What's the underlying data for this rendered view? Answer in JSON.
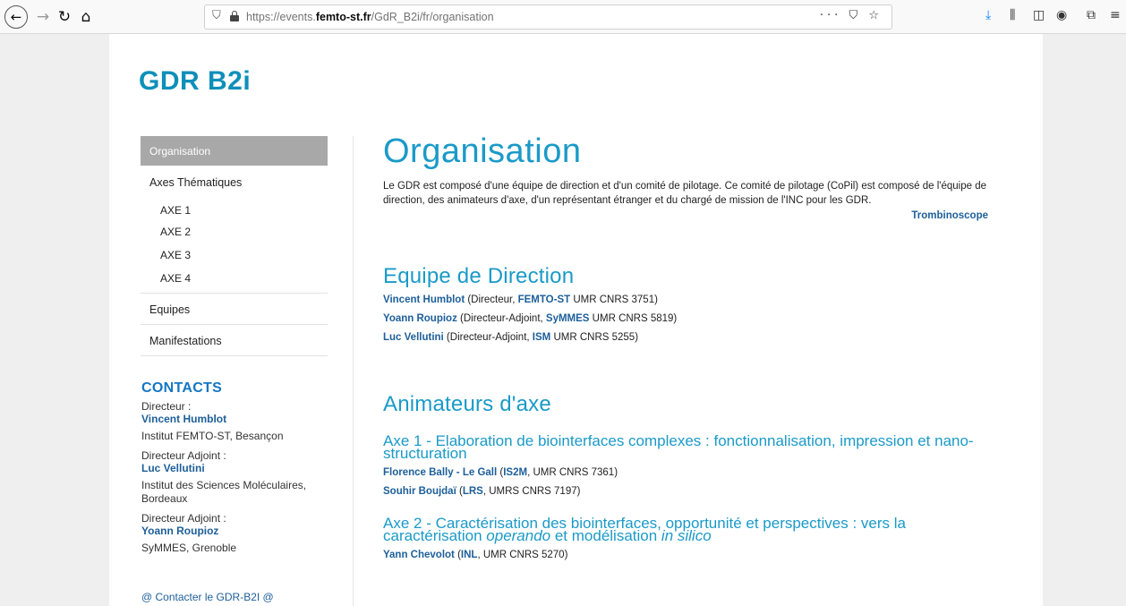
{
  "browser": {
    "url_prefix": "https://events.",
    "url_domain": "femto-st.fr",
    "url_path": "/GdR_B2i/fr/organisation",
    "url_actions": "··· ⛉ ☆"
  },
  "site": {
    "logo": "GDR B2i"
  },
  "sidebar": {
    "active": "Organisation",
    "axes_label": "Axes Thématiques",
    "axes": [
      "AXE 1",
      "AXE 2",
      "AXE 3",
      "AXE 4"
    ],
    "equipes": "Equipes",
    "manifestations": "Manifestations"
  },
  "contacts": {
    "title": "CONTACTS",
    "directeur_label": "Directeur :",
    "directeur_name": "Vincent Humblot",
    "directeur_inst": "Institut FEMTO-ST, Besançon",
    "adjoint1_label": "Directeur Adjoint :",
    "adjoint1_name": "Luc Vellutini",
    "adjoint1_inst": "Institut des Sciences Moléculaires, Bordeaux",
    "adjoint2_label": "Directeur Adjoint :",
    "adjoint2_name": "Yoann Roupioz",
    "adjoint2_inst": "SyMMES, Grenoble",
    "contact_link": "@ Contacter le GDR-B2I @"
  },
  "main": {
    "title": "Organisation",
    "intro": "Le GDR est composé d'une équipe de direction et d'un comité de pilotage. Ce comité de pilotage (CoPil) est composé de l'équipe de direction, des animateurs d'axe, d'un représentant étranger et du chargé de mission de l'INC pour les GDR.",
    "trombinoscope": "Trombinoscope",
    "direction_title": "Equipe de Direction",
    "direction": [
      {
        "name": "Vincent Humblot",
        "mid": " (Directeur, ",
        "inst": "FEMTO-ST",
        "tail": " UMR CNRS 3751)"
      },
      {
        "name": "Yoann Roupioz",
        "mid": " (Directeur-Adjoint, ",
        "inst": "SyMMES",
        "tail": " UMR CNRS 5819)"
      },
      {
        "name": "Luc Vellutini",
        "mid": " (Directeur-Adjoint, ",
        "inst": "ISM",
        "tail": " UMR CNRS 5255)"
      }
    ],
    "animateurs_title": "Animateurs d'axe",
    "axe1_title": "Axe 1 - Elaboration de biointerfaces complexes : fonctionnalisation, impression et nano-structuration",
    "axe1_people": [
      {
        "name": "Florence Bally - Le Gall",
        "mid": " (",
        "inst": "IS2M",
        "tail": ", UMR CNRS 7361)"
      },
      {
        "name": "Souhir Boujdaï",
        "mid": " (",
        "inst": "LRS",
        "tail": ", UMRS CNRS 7197)"
      }
    ],
    "axe2_title_a": "Axe 2 - Caractérisation des biointerfaces, opportunité et perspectives : vers la caractérisation ",
    "axe2_title_b": "operando",
    "axe2_title_c": " et modélisation ",
    "axe2_title_d": "in silico",
    "axe2_people": [
      {
        "name": "Yann Chevolot",
        "mid": " (",
        "inst": "INL",
        "tail": ", UMR CNRS 5270)"
      }
    ]
  }
}
